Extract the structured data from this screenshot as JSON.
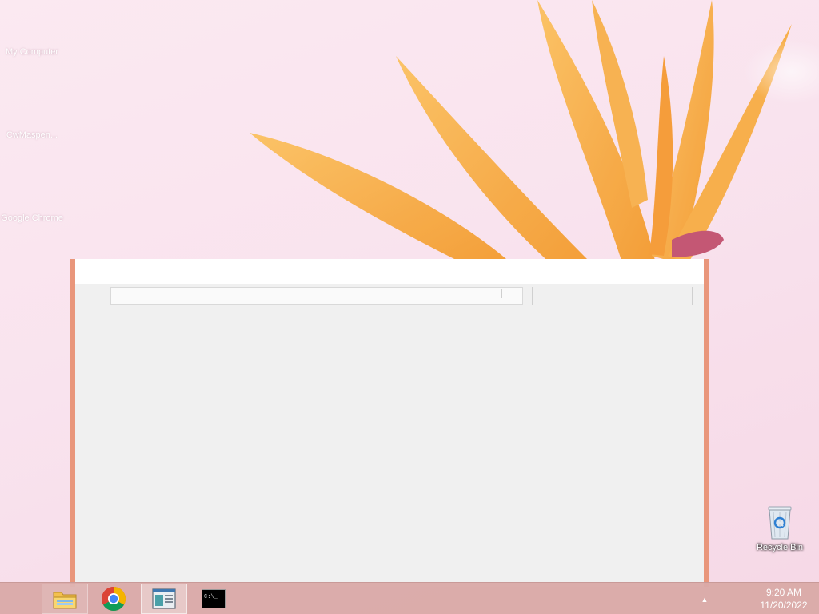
{
  "desktop": {
    "icons": [
      {
        "label": "My Computer"
      },
      {
        "label": "CwMaspen..."
      },
      {
        "label": "Google Chrome"
      }
    ],
    "recycle_bin": {
      "label": "Recycle Bin"
    }
  },
  "window": {
    "title": "",
    "address_value": "",
    "search_value": ""
  },
  "taskbar": {
    "buttons": [
      {
        "name": "File Explorer",
        "state": "pinned"
      },
      {
        "name": "Google Chrome",
        "state": "pinned"
      },
      {
        "name": "Application window",
        "state": "active"
      },
      {
        "name": "Command Prompt",
        "state": "running",
        "glyph": "C:\\_"
      }
    ],
    "tray_chevron": "▲",
    "clock": {
      "time": "9:20 AM",
      "date": "11/20/2022"
    }
  },
  "colors": {
    "window_border": "#e9967b",
    "taskbar": "#daaaa8",
    "flower": "#f7a93f"
  }
}
